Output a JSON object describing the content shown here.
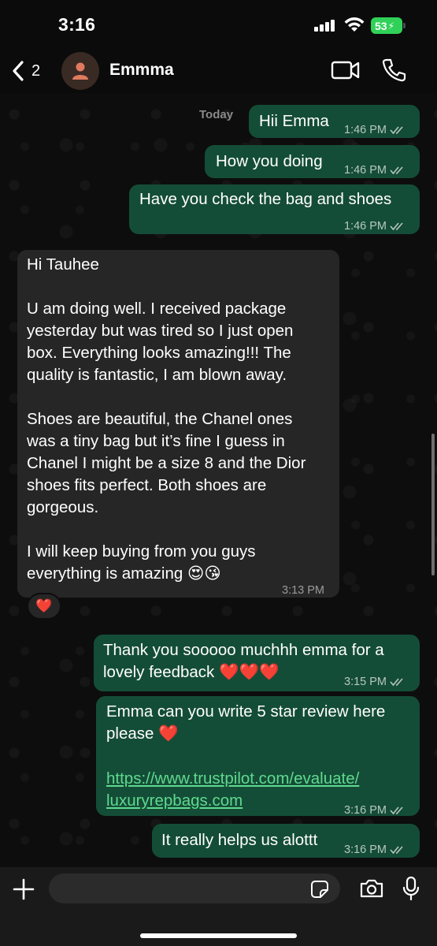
{
  "status_bar": {
    "time": "3:16",
    "battery": "53"
  },
  "header": {
    "back_count": "2",
    "contact_name": "Emmma"
  },
  "chat": {
    "date_divider": "Today",
    "messages": [
      {
        "direction": "outgoing",
        "text": "Hii Emma",
        "time": "1:46 PM"
      },
      {
        "direction": "outgoing",
        "text": "How you doing",
        "time": "1:46 PM"
      },
      {
        "direction": "outgoing",
        "text": "Have you check the bag and shoes",
        "time": "1:46 PM"
      },
      {
        "direction": "incoming",
        "text": "Hi Tauhee\n\nU am doing well. I received package\nyesterday but was tired so I just open\nbox. Everything looks amazing!!! The\nquality is fantastic, I am blown away.\n\nShoes are beautiful, the Chanel ones\nwas a tiny bag but it’s fine I guess in\nChanel I might be a size 8 and the Dior\nshoes fits perfect. Both shoes are\ngorgeous.\n\nI will keep buying from you guys\neverything is amazing 😍😘",
        "time": "3:13 PM",
        "reaction": "❤️"
      },
      {
        "direction": "outgoing",
        "text": "Thank you sooooo muchhh emma for a\nlovely feedback ❤️❤️❤️",
        "time": "3:15 PM"
      },
      {
        "direction": "outgoing",
        "text": "Emma can you write 5 star review here\nplease ❤️",
        "link": "https://www.trustpilot.com/evaluate/\nluxuryrepbags.com",
        "time": "3:16 PM"
      },
      {
        "direction": "outgoing",
        "text": "It really helps us alottt",
        "time": "3:16 PM"
      }
    ]
  },
  "input": {
    "value": "",
    "placeholder": ""
  },
  "icons": {
    "back": "chevron-left-icon",
    "video": "video-camera-icon",
    "call": "phone-icon",
    "attach": "plus-icon",
    "sticker": "sticker-icon",
    "camera": "camera-icon",
    "mic": "microphone-icon"
  },
  "colors": {
    "outgoing_bubble": "#144d37",
    "incoming_bubble": "#262626",
    "link": "#5fd98f",
    "battery": "#30d158"
  }
}
